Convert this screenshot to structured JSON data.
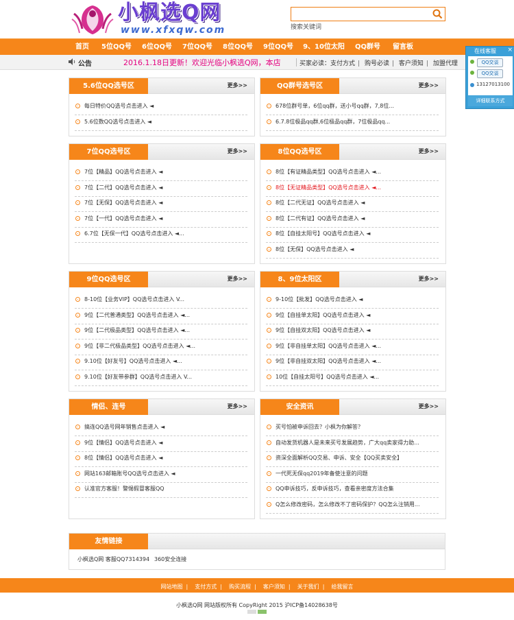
{
  "header": {
    "logo_text": "小枫选Q网",
    "logo_url": "www.xfxqw.com",
    "search_placeholder": "",
    "search_hint": "搜索关键词"
  },
  "nav": [
    "首页",
    "5位QQ号",
    "6位QQ号",
    "7位QQ号",
    "8位QQ号",
    "9位QQ号",
    "9、10位太阳",
    "QQ群号",
    "留言板"
  ],
  "notice": {
    "label": "公告",
    "text": "2016.1.18日更新！欢迎光临小枫选Q网，本店",
    "links": [
      "买家必读：支付方式",
      "购号必读",
      "客户须知",
      "加盟代理"
    ]
  },
  "float_panel": {
    "title": "在线客服",
    "close": "×",
    "qq1": "QQ交谈",
    "qq2": "QQ交谈",
    "phone": "13127013100",
    "footer": "详细联系方式"
  },
  "more_label": "更多>>",
  "boxes": [
    {
      "title": "5.6位QQ选号区",
      "items": [
        "每日特价QQ选号点击进入 ◄",
        "5.6位数QQ选号点击进入 ◄"
      ]
    },
    {
      "title": "QQ群号选号区",
      "items": [
        "678位群号单，6位qq群，送小号qq群，7,8位...",
        "6.7.8位极品qq群,6位极品qq群，7位极品qq..."
      ]
    },
    {
      "title": "7位QQ选号区",
      "items": [
        "7位【精品】QQ选号点击进入 ◄",
        "7位【二代】QQ选号点击进入 ◄",
        "7位【无保】QQ选号点击进入 ◄",
        "7位【一代】QQ选号点击进入 ◄",
        "6.7位【无保一代】QQ选号点击进入 ◄..."
      ]
    },
    {
      "title": "8位QQ选号区",
      "items": [
        "8位【有证精品类型】QQ选号点击进入 ◄...",
        "8位【无证精品类型】QQ选号点击进入 ◄...",
        "8位【二代无证】QQ选号点击进入 ◄",
        "8位【二代有证】QQ选号点击进入 ◄",
        "8位【自挂太阳号】QQ选号点击进入 ◄",
        "8位【无保】QQ选号点击进入 ◄"
      ],
      "red_index": 1
    },
    {
      "title": "9位QQ选号区",
      "items": [
        "8-10位【业务VIP】QQ选号点击进入 V...",
        "9位【二代普通类型】QQ选号点击进入 ◄...",
        "9位【二代极品类型】QQ选号点击进入 ◄...",
        "9位【非二代极品类型】QQ选号点击进入 ◄...",
        "9.10位【好友号】QQ选号点击进入 ◄...",
        "9.10位【好友带参群】QQ选号点击进入 V..."
      ]
    },
    {
      "title": "8、9位太阳区",
      "items": [
        "9-10位【批发】QQ选号点击进入 ◄",
        "9位【自挂单太阳】QQ选号点击进入 ◄",
        "9位【自挂双太阳】QQ选号点击进入 ◄",
        "9位【非自挂单太阳】QQ选号点击进入 ◄...",
        "9位【非自挂双太阳】QQ选号点击进入 ◄...",
        "10位【自挂太阳号】QQ选号点击进入 ◄..."
      ]
    },
    {
      "title": "情侣、连号",
      "items": [
        "搞连QQ选号网年销售点击进入 ◄",
        "9位【情侣】QQ选号点击进入 ◄",
        "8位【情侣】QQ选号点击进入 ◄",
        "网站163邮箱账号QQ选号点击进入 ◄",
        "认准官方客服！警惕假冒客服QQ"
      ]
    },
    {
      "title": "安全资讯",
      "items": [
        "买号怕被申诉回去？小枫为你解答？",
        "自动发货机器人是未来买号发展趋势，广大qq卖家得力助...",
        "资深全面解析QQ交易、申诉、安全【QQ买卖安全】",
        "一代死无保qq2019年备使注意的问题",
        "QQ申诉技巧，反申诉技巧，查看亲密度方法合集",
        "Q怎么修改密码，怎么修改不了密码保护？QQ怎么注销用..."
      ]
    }
  ],
  "friend_links": {
    "title": "友情链接",
    "items": [
      "小枫选Q网 客服QQ7314394",
      "360安全连接"
    ]
  },
  "footer": {
    "links": [
      "网站地图",
      "支付方式",
      "购买流程",
      "客户须知",
      "关于我们",
      "给我留言"
    ],
    "copyright": "小枫选Q网 网站版权所有 CopyRight 2015 沪ICP备14028638号"
  },
  "colors": {
    "accent": "#f6861a",
    "notice": "#e4007f",
    "red_item": "#e3141b",
    "panel": "#3aa0d8"
  }
}
